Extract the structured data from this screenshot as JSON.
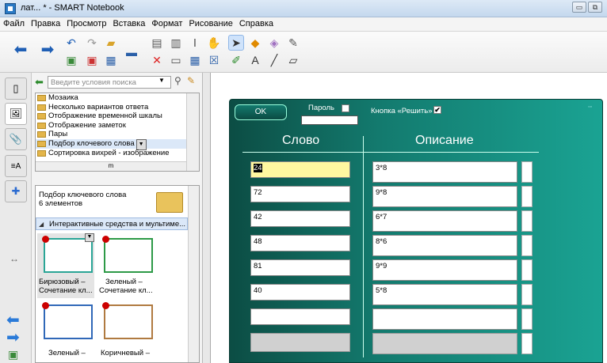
{
  "window": {
    "title": "лат... * - SMART Notebook",
    "controls": [
      "minimize",
      "restore"
    ]
  },
  "menu": [
    "Файл",
    "Правка",
    "Просмотр",
    "Вставка",
    "Формат",
    "Рисование",
    "Справка"
  ],
  "gallery": {
    "search_placeholder": "Введите условия поиска",
    "tree_items": [
      "Мозаика",
      "Несколько вариантов ответа",
      "Отображение временной шкалы",
      "Отображение заметок",
      "Пары",
      "Подбор клочевого слова",
      "Сортировка вихрей - изображение"
    ],
    "selected_tree_item": 5,
    "folder_title": "Подбор ключевого слова",
    "folder_count": "6 элементов",
    "category": "Интерактивные средства и мультиме...",
    "thumbs": [
      {
        "line1": "Бирюзовый –",
        "line2": "Сочетание кл..."
      },
      {
        "line1": "Зеленый –",
        "line2": "Сочетание кл..."
      },
      {
        "line1": "Зеленый –",
        "line2": ""
      },
      {
        "line1": "Коричневый –",
        "line2": ""
      }
    ],
    "scroll_mark": "m"
  },
  "widget": {
    "ok_label": "OK",
    "password_label": "Пароль",
    "solve_label": "Кнопка «Решить»",
    "solve_checked": true,
    "col_word": "Слово",
    "col_desc": "Описание",
    "rows": [
      {
        "word": "24",
        "desc": "3*8"
      },
      {
        "word": "72",
        "desc": "9*8"
      },
      {
        "word": "42",
        "desc": "6*7"
      },
      {
        "word": "48",
        "desc": "8*6"
      },
      {
        "word": "81",
        "desc": "9*9"
      },
      {
        "word": "40",
        "desc": "5*8"
      },
      {
        "word": "",
        "desc": ""
      },
      {
        "word": "",
        "desc": ""
      }
    ]
  }
}
